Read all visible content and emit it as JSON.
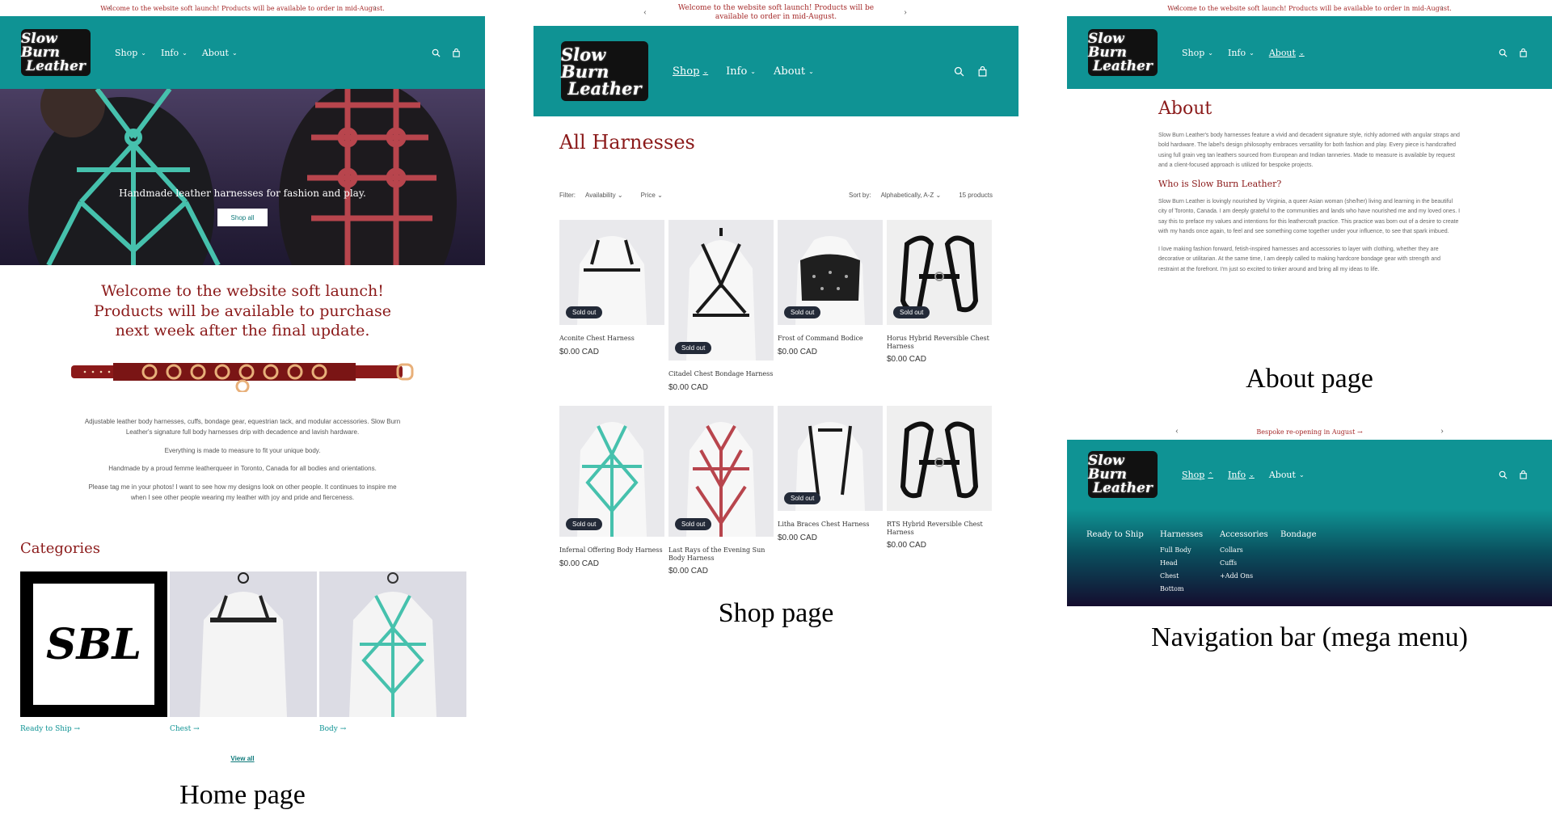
{
  "announcement": "Welcome to the website soft launch! Products will be available to order in mid-August.",
  "announcement_2": "Bespoke re-opening in August",
  "brand": {
    "line1": "Slow Burn",
    "line2": "Leather"
  },
  "nav": {
    "shop": "Shop",
    "info": "Info",
    "about": "About"
  },
  "home": {
    "hero_text": "Handmade leather harnesses for fashion and play.",
    "hero_button": "Shop all",
    "welcome": "Welcome to the website soft launch! Products will be available to purchase next week after the final update.",
    "p1": "Adjustable leather body harnesses, cuffs, bondage gear, equestrian tack, and modular accessories. Slow Burn Leather's signature full body harnesses drip with decadence and lavish hardware.",
    "p2": "Everything is made to measure to fit your unique body.",
    "p3": "Handmade by a proud femme leatherqueer in Toronto, Canada for all bodies and orientations.",
    "p4": "Please tag me in your photos! I want to see how my designs look on other people. It continues to inspire me when I see other people wearing my leather with joy and pride and fierceness.",
    "categories_title": "Categories",
    "categories": [
      {
        "label": "Ready to Ship →"
      },
      {
        "label": "Chest →"
      },
      {
        "label": "Body →"
      }
    ],
    "view_all": "View all",
    "sbl_text": "SBL"
  },
  "shop": {
    "title": "All Harnesses",
    "filter_label": "Filter:",
    "availability": "Availability",
    "price": "Price",
    "sort_label": "Sort by:",
    "sort_value": "Alphabetically, A-Z",
    "count": "15 products",
    "sold_out": "Sold out",
    "products": [
      {
        "name": "Aconite Chest Harness",
        "price": "$0.00 CAD",
        "sold": true
      },
      {
        "name": "Citadel Chest Bondage Harness",
        "price": "$0.00 CAD",
        "sold": true
      },
      {
        "name": "Frost of Command Bodice",
        "price": "$0.00 CAD",
        "sold": true
      },
      {
        "name": "Horus Hybrid Reversible Chest Harness",
        "price": "$0.00 CAD",
        "sold": true
      },
      {
        "name": "Infernal Offering Body Harness",
        "price": "$0.00 CAD",
        "sold": true
      },
      {
        "name": "Last Rays of the Evening Sun Body Harness",
        "price": "$0.00 CAD",
        "sold": true
      },
      {
        "name": "Litha Braces Chest Harness",
        "price": "$0.00 CAD",
        "sold": true
      },
      {
        "name": "RTS Hybrid Reversible Chest Harness",
        "price": "$0.00 CAD",
        "sold": false
      }
    ]
  },
  "about": {
    "title": "About",
    "p1": "Slow Burn Leather's body harnesses feature a vivid and decadent signature style, richly adorned with angular straps and bold hardware. The label's design philosophy embraces versatility for both fashion and play. Every piece is handcrafted using full grain veg tan leathers sourced from European and Indian tanneries. Made to measure is available by request and a client-focused approach is utilized for bespoke projects.",
    "subtitle": "Who is Slow Burn Leather?",
    "p2": "Slow Burn Leather is lovingly nourished by Virginia, a queer Asian woman (she/her) living and learning in the beautiful city of Toronto, Canada. I am deeply grateful to the communities and lands who have nourished me and my loved ones. I say this to preface my values and intentions for this leathercraft practice. This practice was born out of a desire to create with my hands once again, to feel and see something come together under your influence, to see that spark imbued.",
    "p3": "I love making fashion forward, fetish-inspired harnesses and accessories to layer with clothing, whether they are decorative or utilitarian. At the same time, I am deeply called to making hardcore bondage gear with strength and restraint at the forefront. I'm just so excited to tinker around and bring all my ideas to life."
  },
  "mega": {
    "col1": "Ready to Ship",
    "col2": "Harnesses",
    "col2_items": [
      "Full Body",
      "Head",
      "Chest",
      "Bottom"
    ],
    "col3": "Accessories",
    "col3_items": [
      "Collars",
      "Cuffs",
      "+Add Ons"
    ],
    "col4": "Bondage"
  },
  "captions": {
    "home": "Home page",
    "shop": "Shop page",
    "about": "About page",
    "nav": "Navigation bar  (mega menu)"
  },
  "colors": {
    "teal": "#0f9394",
    "maroon": "#8b1a1a",
    "turquoise": "#46c1ad",
    "red_leather": "#b8454d"
  }
}
